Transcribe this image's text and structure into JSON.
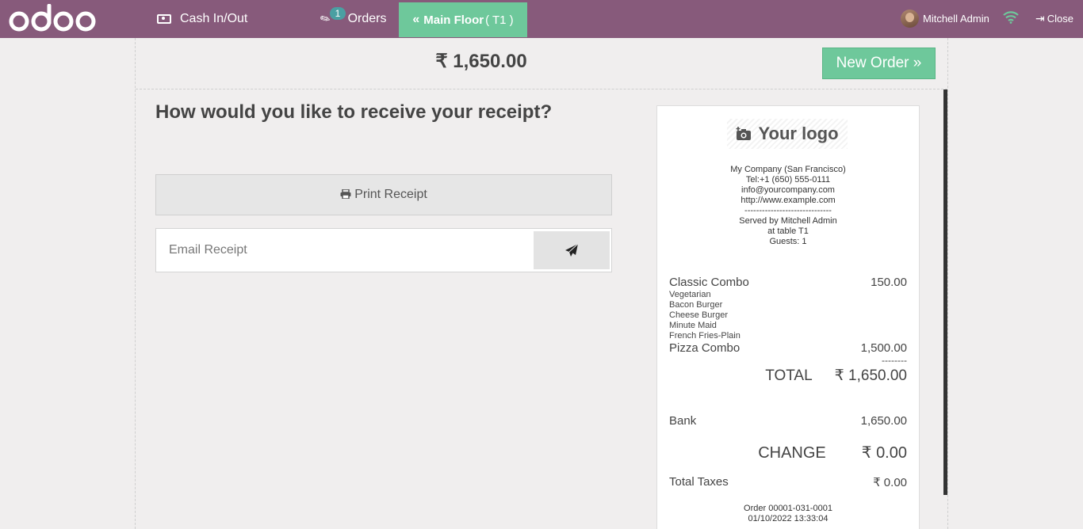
{
  "brand": "odoo",
  "topbar": {
    "cash_label": "Cash In/Out",
    "orders_label": "Orders",
    "orders_count": "1",
    "floor_label": "Main Floor",
    "floor_table": "( T1 )",
    "user_name": "Mitchell Admin",
    "close_label": "Close"
  },
  "payment": {
    "total_due": "₹ 1,650.00",
    "new_order_label": "New Order »"
  },
  "receipt_prompt": {
    "question": "How would you like to receive your receipt?",
    "print_label": "Print Receipt",
    "email_placeholder": "Email Receipt"
  },
  "receipt": {
    "logo_text": "Your logo",
    "contact_lines": [
      "My Company (San Francisco)",
      "Tel:+1 (650) 555-0111",
      "info@yourcompany.com",
      "http://www.example.com",
      "------------------------------",
      "Served by Mitchell Admin",
      "at table T1",
      "Guests: 1"
    ],
    "lines": [
      {
        "name": "Classic Combo",
        "price": "150.00",
        "subitems": [
          "Vegetarian",
          "Bacon Burger",
          "Cheese Burger",
          "Minute Maid",
          "French Fries-Plain"
        ]
      },
      {
        "name": "Pizza Combo",
        "price": "1,500.00",
        "subitems": []
      }
    ],
    "separator": "--------",
    "total_label": "TOTAL",
    "total_value": "₹ 1,650.00",
    "payment_method": "Bank",
    "payment_amount": "1,650.00",
    "change_label": "CHANGE",
    "change_value": "₹ 0.00",
    "taxes_label": "Total Taxes",
    "taxes_value": "₹ 0.00",
    "order_ref": "Order 00001-031-0001",
    "order_date": "01/10/2022 13:33:04"
  },
  "colors": {
    "topbar": "#875a7b",
    "accent_green": "#6ec89b",
    "badge": "#4a9fa2"
  }
}
